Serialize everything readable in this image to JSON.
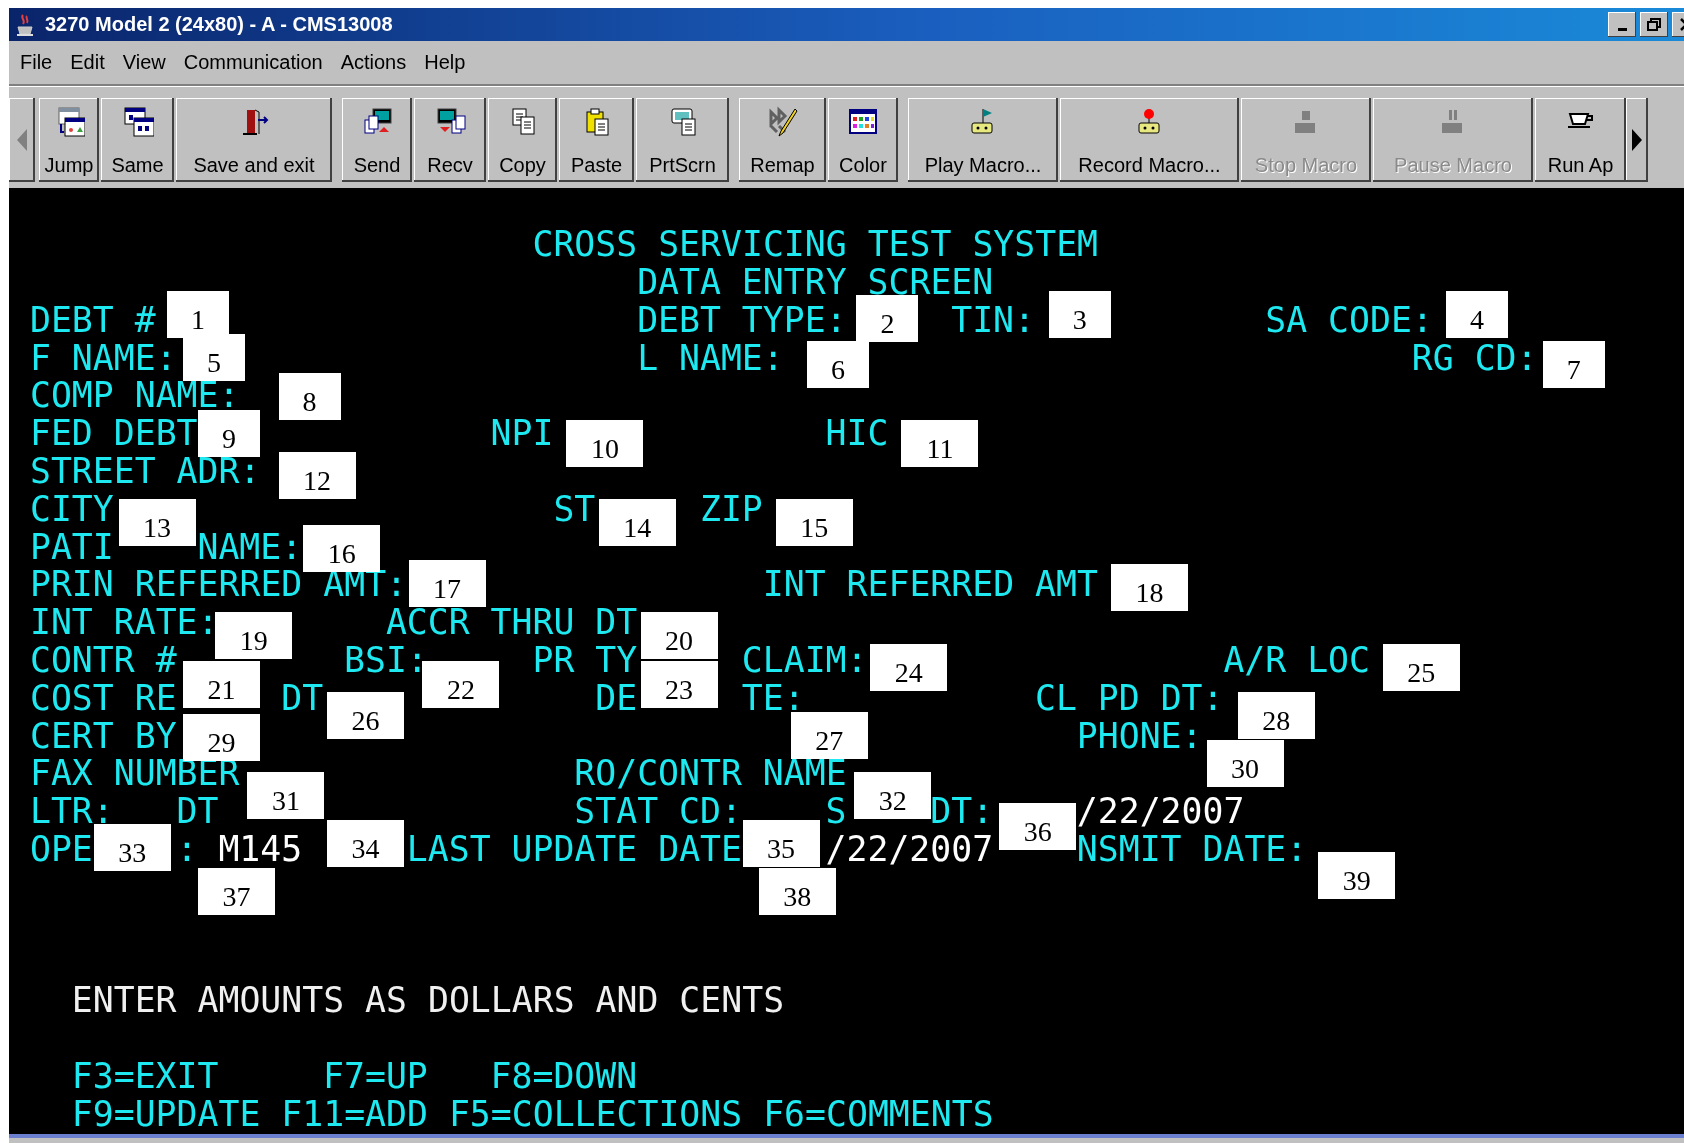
{
  "window": {
    "title": "3270 Model 2 (24x80) - A - CMS13008"
  },
  "menu": [
    "File",
    "Edit",
    "View",
    "Communication",
    "Actions",
    "Help"
  ],
  "toolbar": {
    "groups": [
      {
        "buttons": [
          {
            "label": "Jump",
            "disabled": false
          },
          {
            "label": "Same",
            "disabled": false
          },
          {
            "label": "Save and exit",
            "disabled": false
          }
        ]
      },
      {
        "buttons": [
          {
            "label": "Send",
            "disabled": false
          },
          {
            "label": "Recv",
            "disabled": false
          },
          {
            "label": "Copy",
            "disabled": false
          },
          {
            "label": "Paste",
            "disabled": false
          },
          {
            "label": "PrtScrn",
            "disabled": false
          }
        ]
      },
      {
        "buttons": [
          {
            "label": "Remap",
            "disabled": false
          },
          {
            "label": "Color",
            "disabled": false
          }
        ]
      },
      {
        "buttons": [
          {
            "label": "Play Macro...",
            "disabled": false
          },
          {
            "label": "Record Macro...",
            "disabled": false
          },
          {
            "label": "Stop Macro",
            "disabled": true
          },
          {
            "label": "Pause Macro",
            "disabled": true
          },
          {
            "label": "Run Ap",
            "disabled": false
          }
        ]
      }
    ]
  },
  "terminal": {
    "rows": [
      {
        "segments": [
          {
            "kind": "title",
            "text": "CROSS SERVICING TEST SYSTEM"
          }
        ]
      },
      {
        "segments": [
          {
            "kind": "title",
            "text": "DATA ENTRY SCREEN"
          }
        ]
      },
      {
        "segments": [
          {
            "kind": "label",
            "text": "DEBT #"
          },
          {
            "kind": "label",
            "text": "DEBT TYPE:"
          },
          {
            "kind": "label",
            "text": "TIN:"
          },
          {
            "kind": "label",
            "text": "SA CODE:"
          }
        ]
      },
      {
        "segments": [
          {
            "kind": "label",
            "text": "F NAME:"
          },
          {
            "kind": "label",
            "text": "L NAME:"
          },
          {
            "kind": "label",
            "text": "RG CD:"
          }
        ]
      },
      {
        "segments": [
          {
            "kind": "label",
            "text": "COMP NAME:"
          }
        ]
      },
      {
        "segments": [
          {
            "kind": "label",
            "text": "FED DEBT"
          },
          {
            "kind": "label",
            "text": "NPI"
          },
          {
            "kind": "label",
            "text": "HIC"
          }
        ]
      },
      {
        "segments": [
          {
            "kind": "label",
            "text": "STREET ADR:"
          }
        ]
      },
      {
        "segments": [
          {
            "kind": "label",
            "text": "CITY"
          },
          {
            "kind": "label",
            "text": "ST"
          },
          {
            "kind": "label",
            "text": "ZIP"
          }
        ]
      },
      {
        "segments": [
          {
            "kind": "label",
            "text": "PATI"
          },
          {
            "kind": "label",
            "text": "NAME:"
          }
        ]
      },
      {
        "segments": [
          {
            "kind": "label",
            "text": "PRIN REFERRED AMT:"
          },
          {
            "kind": "label",
            "text": "INT REFERRED AMT"
          }
        ]
      },
      {
        "segments": [
          {
            "kind": "label",
            "text": "INT RATE:"
          },
          {
            "kind": "label",
            "text": "ACCR THRU DT"
          }
        ]
      },
      {
        "segments": [
          {
            "kind": "label",
            "text": "CONTR #"
          },
          {
            "kind": "label",
            "text": "BSI:"
          },
          {
            "kind": "label",
            "text": "PR TY"
          },
          {
            "kind": "label",
            "text": "CLAIM:"
          },
          {
            "kind": "label",
            "text": "A/R LOC"
          }
        ]
      },
      {
        "segments": [
          {
            "kind": "label",
            "text": "COST RE"
          },
          {
            "kind": "label",
            "text": "DT"
          },
          {
            "kind": "label",
            "text": "DE"
          },
          {
            "kind": "label",
            "text": "TE:"
          },
          {
            "kind": "label",
            "text": "CL PD DT:"
          }
        ]
      },
      {
        "segments": [
          {
            "kind": "label",
            "text": "CERT BY"
          },
          {
            "kind": "label",
            "text": "PHONE:"
          }
        ]
      },
      {
        "segments": [
          {
            "kind": "label",
            "text": "FAX NUMBER"
          },
          {
            "kind": "label",
            "text": "RO/CONTR NAME"
          }
        ]
      },
      {
        "segments": [
          {
            "kind": "label",
            "text": "LTR:"
          },
          {
            "kind": "label",
            "text": "DT"
          },
          {
            "kind": "label",
            "text": "STAT CD:"
          },
          {
            "kind": "label",
            "text": "S"
          },
          {
            "kind": "label",
            "text": "DT:"
          },
          {
            "kind": "value",
            "text": "/22/2007"
          }
        ]
      },
      {
        "segments": [
          {
            "kind": "label",
            "text": "OPE"
          },
          {
            "kind": "label",
            "text": ":"
          },
          {
            "kind": "value",
            "text": "M145"
          },
          {
            "kind": "label",
            "text": "LAST UPDATE DATE"
          },
          {
            "kind": "value",
            "text": "/22/2007"
          },
          {
            "kind": "label",
            "text": "NSMIT DATE:"
          }
        ]
      },
      {
        "segments": [
          {
            "kind": "message",
            "text": "ENTER AMOUNTS AS DOLLARS AND CENTS"
          }
        ]
      },
      {
        "segments": [
          {
            "kind": "keys",
            "text": "F3=EXIT"
          },
          {
            "kind": "keys",
            "text": "F7=UP"
          },
          {
            "kind": "keys",
            "text": "F8=DOWN"
          }
        ]
      },
      {
        "segments": [
          {
            "kind": "keys",
            "text": "F9=UPDATE F11=ADD F5=COLLECTIONS F6=COMMENTS"
          }
        ]
      }
    ]
  },
  "callouts": [
    "1",
    "2",
    "3",
    "4",
    "5",
    "6",
    "7",
    "8",
    "9",
    "10",
    "11",
    "12",
    "13",
    "14",
    "15",
    "16",
    "17",
    "18",
    "19",
    "20",
    "21",
    "22",
    "23",
    "24",
    "25",
    "26",
    "27",
    "28",
    "29",
    "30",
    "31",
    "32",
    "33",
    "34",
    "35",
    "36",
    "37",
    "38",
    "39"
  ]
}
